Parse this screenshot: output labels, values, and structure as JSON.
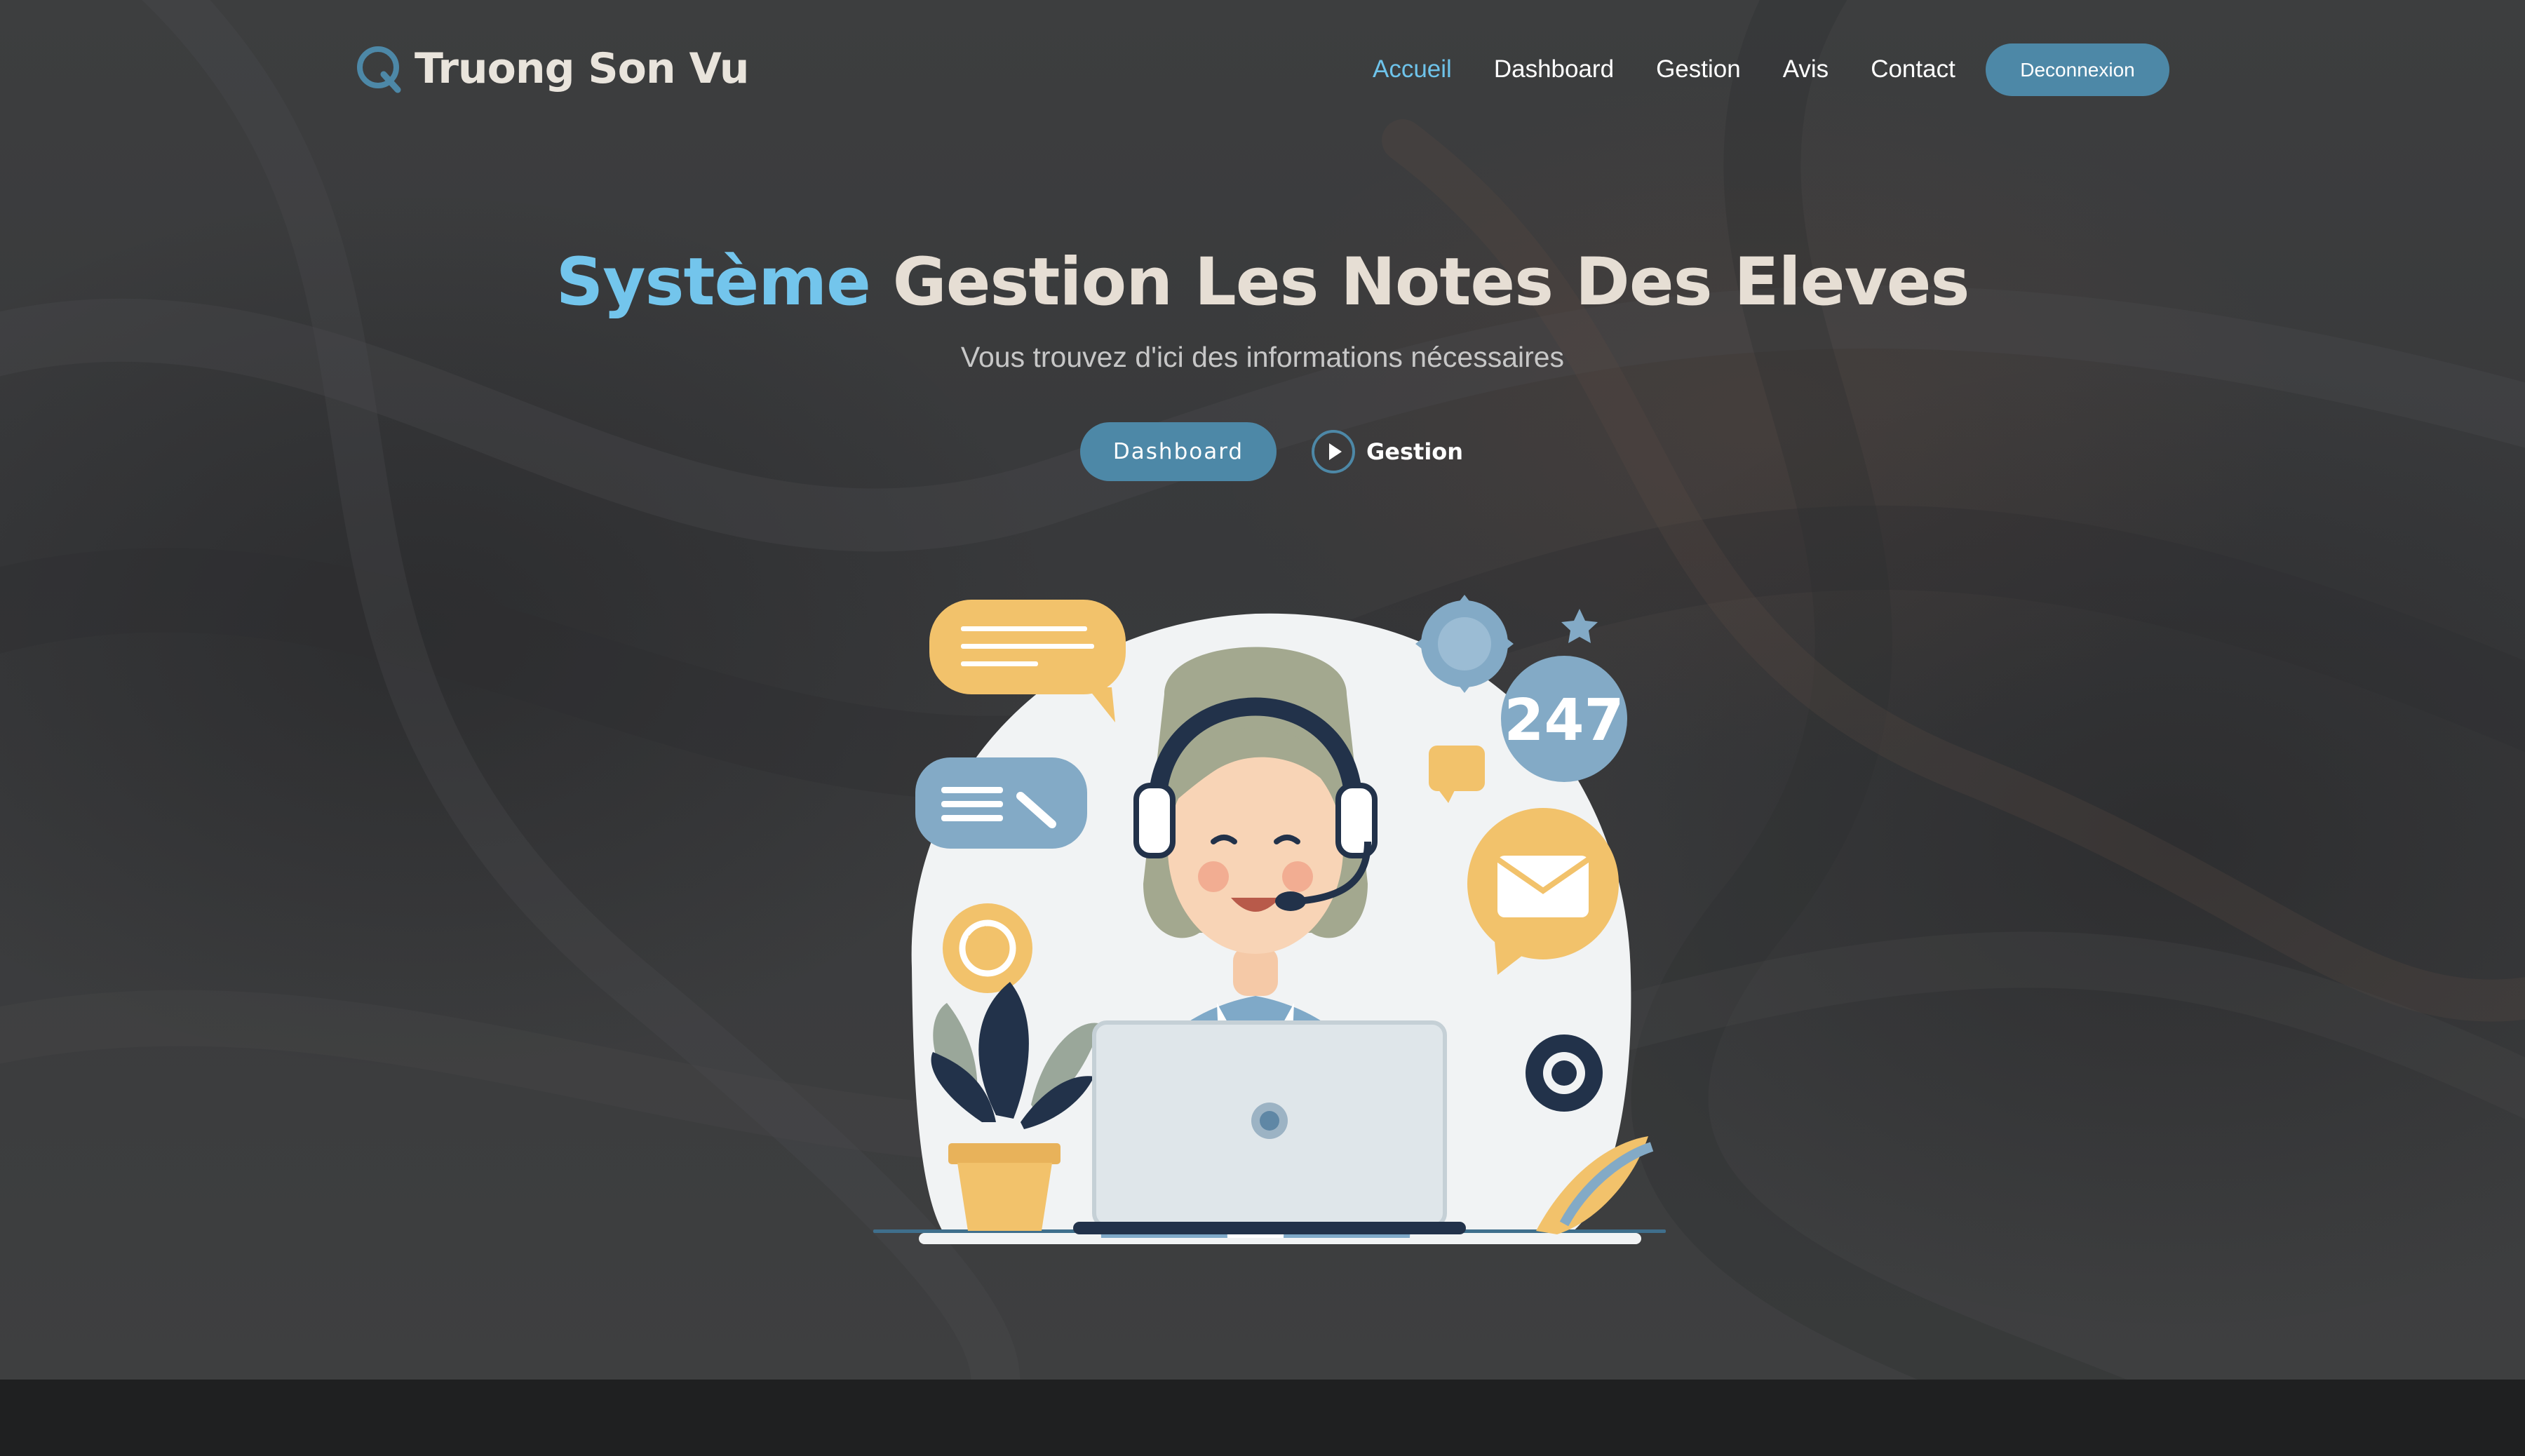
{
  "brand": {
    "name": "Truong Son Vu",
    "logo_icon": "q-logo-icon"
  },
  "nav": {
    "links": [
      {
        "label": "Accueil",
        "active": true
      },
      {
        "label": "Dashboard",
        "active": false
      },
      {
        "label": "Gestion",
        "active": false
      },
      {
        "label": "Avis",
        "active": false
      },
      {
        "label": "Contact",
        "active": false
      }
    ],
    "logout_label": "Deconnexion"
  },
  "hero": {
    "title_accent": "Système",
    "title_rest": "Gestion Les Notes Des Eleves",
    "subtitle": "Vous trouvez d'ici des informations nécessaires",
    "primary_cta": "Dashboard",
    "secondary_cta": "Gestion",
    "secondary_icon": "play-circle-icon"
  },
  "illustration": {
    "badge_text": "247"
  },
  "colors": {
    "accent": "#73c5ec",
    "button": "#4d88a7",
    "title": "#e6ded4",
    "background": "#3f4041",
    "footer": "#1f2021"
  }
}
